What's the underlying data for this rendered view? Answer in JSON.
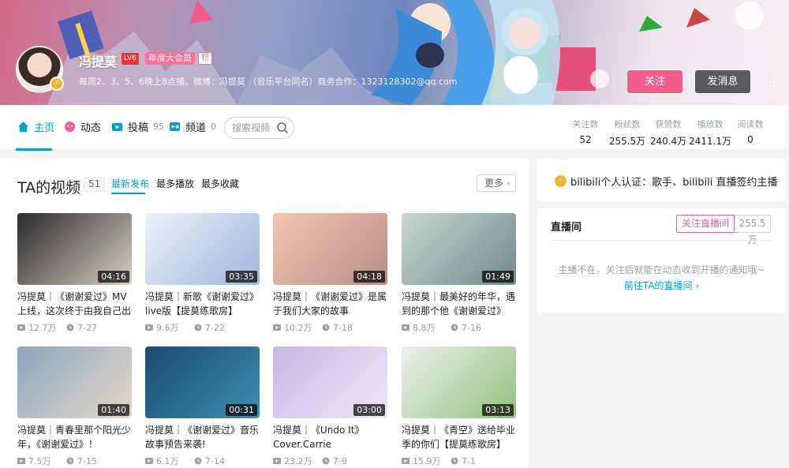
{
  "header": {
    "username": "冯提莫",
    "level": "LV6",
    "vip": "年度大会员",
    "fan_badge": "粉",
    "sign": "每周2、3、5、6晚上8点播。微博：冯提莫 （音乐平台同名）商务合作：1323128302@qq.com",
    "follow_button": "关注",
    "message_button": "发消息"
  },
  "nav": {
    "tabs": [
      {
        "label": "主页",
        "count": ""
      },
      {
        "label": "动态",
        "count": ""
      },
      {
        "label": "投稿",
        "count": "95"
      },
      {
        "label": "频道",
        "count": "0"
      }
    ],
    "search_placeholder": "搜索视频",
    "stats": [
      {
        "label": "关注数",
        "value": "52"
      },
      {
        "label": "粉丝数",
        "value": "255.5万"
      },
      {
        "label": "获赞数",
        "value": "240.4万"
      },
      {
        "label": "播放数",
        "value": "2411.1万"
      },
      {
        "label": "阅读数",
        "value": "0"
      }
    ]
  },
  "videos_section": {
    "title": "TA的视频",
    "count": "51",
    "tabs": [
      "最新发布",
      "最多播放",
      "最多收藏"
    ],
    "more": "更多",
    "items": [
      {
        "title": "冯提莫｜《谢谢爱过》MV上线，这次终于由我自己出演",
        "duration": "04:16",
        "plays": "12.7万",
        "date": "7-27",
        "c1": "#2a2a2a",
        "c2": "#d8cfc6"
      },
      {
        "title": "冯提莫｜新歌《谢谢爱过》live版【提莫练歌房】",
        "duration": "03:35",
        "plays": "9.6万",
        "date": "7-22",
        "c1": "#eef2fb",
        "c2": "#9fb6dd"
      },
      {
        "title": "冯提莫｜《谢谢爱过》是属于我们大家的故事",
        "duration": "04:18",
        "plays": "10.2万",
        "date": "7-18",
        "c1": "#f3c7b2",
        "c2": "#b98e86"
      },
      {
        "title": "冯提莫｜最美好的年华，遇到的那个他《谢谢爱过》",
        "duration": "01:49",
        "plays": "8.8万",
        "date": "7-16",
        "c1": "#c9d7d0",
        "c2": "#6f8a8c"
      },
      {
        "title": "冯提莫｜青春里那个阳光少年，《谢谢爱过》！",
        "duration": "01:40",
        "plays": "7.5万",
        "date": "7-15",
        "c1": "#8ba6c0",
        "c2": "#e7d8c8"
      },
      {
        "title": "冯提莫｜《谢谢爱过》音乐故事预告来袭!",
        "duration": "00:31",
        "plays": "6.1万",
        "date": "7-14",
        "c1": "#1b4b6e",
        "c2": "#3b8fb3"
      },
      {
        "title": "冯提莫｜《Undo It》Cover.Carrie Underwood",
        "duration": "03:00",
        "plays": "23.2万",
        "date": "7-9",
        "c1": "#c8b8e6",
        "c2": "#f0e6f6"
      },
      {
        "title": "冯提莫｜《青空》送给毕业季的你们【提莫练歌房】",
        "duration": "03:13",
        "plays": "15.9万",
        "date": "7-1",
        "c1": "#eef0ee",
        "c2": "#8fc27a"
      }
    ]
  },
  "verify": {
    "text": "bilibili个人认证：歌手、bilibili 直播签约主播"
  },
  "live": {
    "title": "直播间",
    "follow_label": "关注直播间",
    "count": "255.5万",
    "tip": "主播不在，关注后就能在动态收到开播的通知哦~",
    "link": "前往TA的直播间"
  },
  "colors": {
    "accent": "#00a1d6",
    "pink": "#f25d8e"
  }
}
